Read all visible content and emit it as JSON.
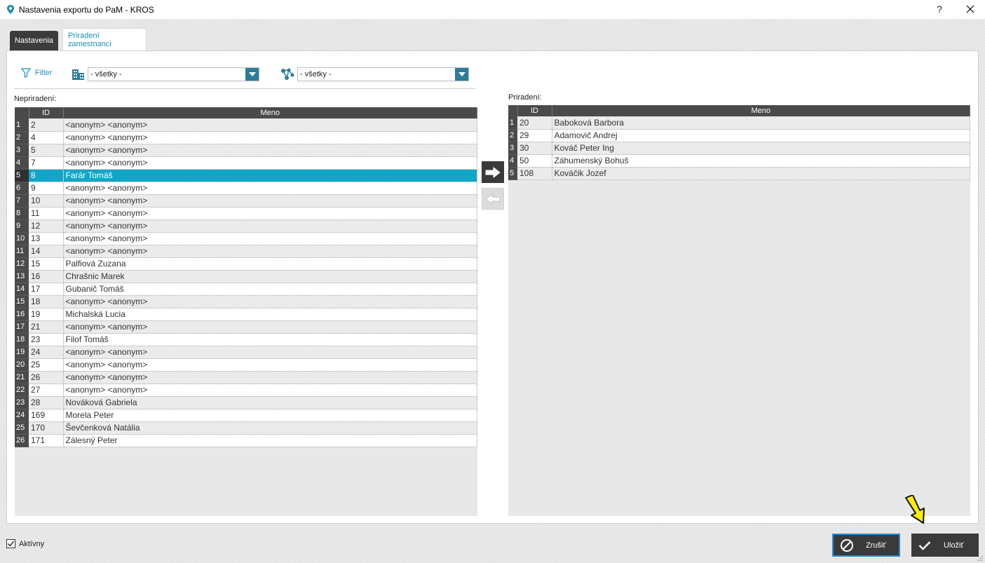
{
  "window": {
    "title": "Nastavenia exportu do PaM - KROS",
    "help_label": "?"
  },
  "tabs": [
    {
      "label": "Nastavenia",
      "active": false
    },
    {
      "label": "Priradení zamestnanci",
      "active": true
    }
  ],
  "filter": {
    "label": "Filter",
    "combo1_value": "- všetky -",
    "combo2_value": "- všetky -"
  },
  "left_grid": {
    "section_label": "Nepriradení:",
    "col_id": "ID",
    "col_name": "Meno",
    "selected_row": 5,
    "rows": [
      {
        "n": "1",
        "id": "2",
        "name": "<anonym> <anonym>"
      },
      {
        "n": "2",
        "id": "4",
        "name": "<anonym> <anonym>"
      },
      {
        "n": "3",
        "id": "5",
        "name": "<anonym> <anonym>"
      },
      {
        "n": "4",
        "id": "7",
        "name": "<anonym> <anonym>"
      },
      {
        "n": "5",
        "id": "8",
        "name": "Farár Tomáš"
      },
      {
        "n": "6",
        "id": "9",
        "name": "<anonym> <anonym>"
      },
      {
        "n": "7",
        "id": "10",
        "name": "<anonym> <anonym>"
      },
      {
        "n": "8",
        "id": "11",
        "name": "<anonym> <anonym>"
      },
      {
        "n": "9",
        "id": "12",
        "name": "<anonym> <anonym>"
      },
      {
        "n": "10",
        "id": "13",
        "name": "<anonym> <anonym>"
      },
      {
        "n": "11",
        "id": "14",
        "name": "<anonym> <anonym>"
      },
      {
        "n": "12",
        "id": "15",
        "name": "Palfiová Zuzana"
      },
      {
        "n": "13",
        "id": "16",
        "name": "Chrašnic Marek"
      },
      {
        "n": "14",
        "id": "17",
        "name": "Gubanič Tomáš"
      },
      {
        "n": "15",
        "id": "18",
        "name": "<anonym> <anonym>"
      },
      {
        "n": "16",
        "id": "19",
        "name": "Michalská Lucia"
      },
      {
        "n": "17",
        "id": "21",
        "name": "<anonym> <anonym>"
      },
      {
        "n": "18",
        "id": "23",
        "name": "Filof Tomáš"
      },
      {
        "n": "19",
        "id": "24",
        "name": "<anonym> <anonym>"
      },
      {
        "n": "20",
        "id": "25",
        "name": "<anonym> <anonym>"
      },
      {
        "n": "21",
        "id": "26",
        "name": "<anonym> <anonym>"
      },
      {
        "n": "22",
        "id": "27",
        "name": "<anonym> <anonym>"
      },
      {
        "n": "23",
        "id": "28",
        "name": "Nováková Gabriela"
      },
      {
        "n": "24",
        "id": "169",
        "name": "Morela Peter"
      },
      {
        "n": "25",
        "id": "170",
        "name": "Ševčenková Natália"
      },
      {
        "n": "26",
        "id": "171",
        "name": "Zálesný Peter"
      }
    ]
  },
  "right_grid": {
    "section_label": "Priradení:",
    "col_id": "ID",
    "col_name": "Meno",
    "rows": [
      {
        "n": "1",
        "id": "20",
        "name": "Baboková Barbora"
      },
      {
        "n": "2",
        "id": "29",
        "name": "Adamovič Andrej"
      },
      {
        "n": "3",
        "id": "30",
        "name": "Kováč Peter Ing"
      },
      {
        "n": "4",
        "id": "50",
        "name": "Záhumenský Bohuš"
      },
      {
        "n": "5",
        "id": "108",
        "name": "Kováčik Jozef"
      }
    ]
  },
  "footer": {
    "active_label": "Aktívny",
    "active_checked": true,
    "cancel_label": "Zrušiť",
    "save_label": "Uložiť"
  },
  "colors": {
    "accent": "#1b8fb5",
    "selection": "#0fa6c9",
    "combo_arrow": "#2b7d9a",
    "dark": "#3a3a3a",
    "cursor": "#ffee00"
  }
}
